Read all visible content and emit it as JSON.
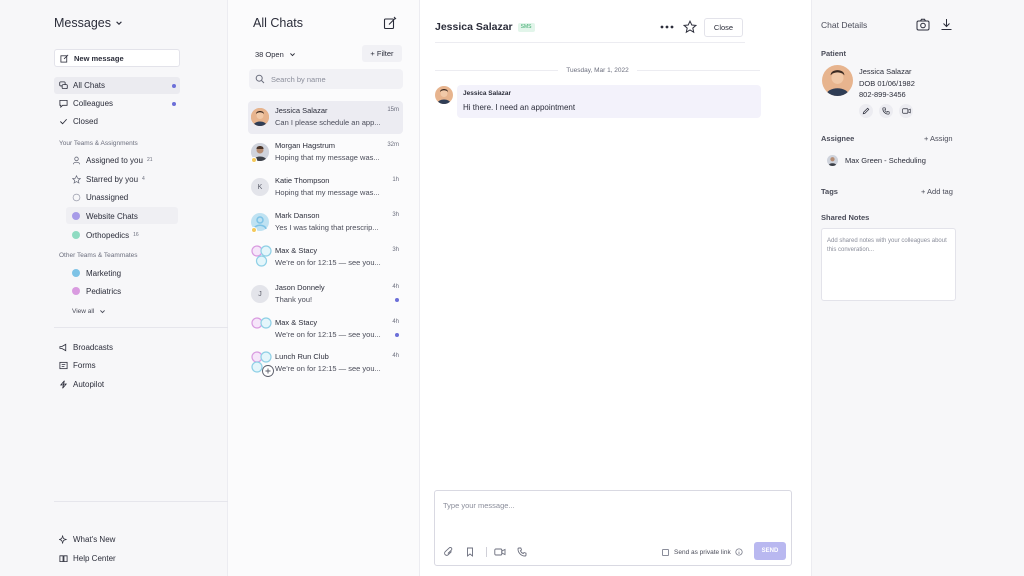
{
  "left": {
    "title": "Messages",
    "new_message": "New message",
    "items": [
      {
        "label": "All Chats"
      },
      {
        "label": "Colleagues"
      },
      {
        "label": "Closed"
      }
    ],
    "teams_header": "Your Teams & Assignments",
    "teams": [
      {
        "label": "Assigned to you",
        "count": "21"
      },
      {
        "label": "Starred by you",
        "count": "4"
      },
      {
        "label": "Unassigned"
      },
      {
        "label": "Website Chats",
        "color": "#a79be8"
      },
      {
        "label": "Orthopedics",
        "count": "16",
        "color": "#8fdbc2"
      }
    ],
    "other_header": "Other Teams & Teammates",
    "others": [
      {
        "label": "Marketing",
        "color": "#7ec3e6"
      },
      {
        "label": "Pediatrics",
        "color": "#d99be0"
      }
    ],
    "view_all": "View all",
    "tools": [
      {
        "label": "Broadcasts"
      },
      {
        "label": "Forms"
      },
      {
        "label": "Autopilot"
      }
    ],
    "footer": [
      {
        "label": "What's New"
      },
      {
        "label": "Help Center"
      }
    ]
  },
  "list": {
    "title": "All Chats",
    "open_filter": "38 Open",
    "filter_label": "+ Filter",
    "search_placeholder": "Search by name",
    "chats": [
      {
        "name": "Jessica Salazar",
        "preview": "Can I please schedule an app...",
        "time": "15m"
      },
      {
        "name": "Morgan Hagstrum",
        "preview": "Hoping that my message was...",
        "time": "32m"
      },
      {
        "name": "Katie Thompson",
        "preview": "Hoping that my message was...",
        "time": "1h",
        "initial": "K"
      },
      {
        "name": "Mark Danson",
        "preview": "Yes I was taking that prescrip...",
        "time": "3h"
      },
      {
        "name": "Max & Stacy",
        "preview": "We’re on for 12:15 — see you...",
        "time": "3h"
      },
      {
        "name": "Jason Donnely",
        "preview": "Thank you!",
        "time": "4h",
        "initial": "J"
      },
      {
        "name": "Max & Stacy",
        "preview": "We’re on for 12:15 — see you...",
        "time": "4h"
      },
      {
        "name": "Lunch Run Club",
        "preview": "We’re on for 12:15 — see you...",
        "time": "4h"
      }
    ]
  },
  "chat": {
    "contact_name": "Jessica Salazar",
    "badge": "SMS",
    "close_label": "Close",
    "date_divider": "Tuesday, Mar 1, 2022",
    "message": {
      "sender": "Jessica Salazar",
      "text": "Hi there. I need an appointment"
    },
    "composer_placeholder": "Type your message...",
    "private_link_label": "Send as private link",
    "send_label": "SEND"
  },
  "details": {
    "title": "Chat Details",
    "patient_label": "Patient",
    "patient_name": "Jessica Salazar",
    "patient_dob": "DOB 01/06/1982",
    "patient_phone": "802-899-3456",
    "assignee_label": "Assignee",
    "assign_action": "+ Assign",
    "assignee_name": "Max Green - Scheduling",
    "tags_label": "Tags",
    "add_tag": "+ Add tag",
    "notes_label": "Shared Notes",
    "notes_placeholder": "Add shared notes with your colleagues about this converation..."
  },
  "colors": {
    "accent": "#6c6fd8",
    "send_button": "#b9b8f0",
    "sms_badge_bg": "#e2f5ea",
    "sms_badge_fg": "#3aa86b",
    "message_bubble": "#f3f2fb"
  }
}
